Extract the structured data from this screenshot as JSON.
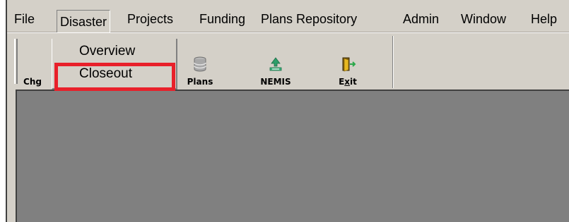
{
  "menubar": {
    "items": [
      "File",
      "Disaster",
      "Projects",
      "Funding",
      "Plans Repository",
      "Admin",
      "Window",
      "Help"
    ]
  },
  "dropdown": {
    "items": [
      "Overview",
      "Closeout"
    ],
    "highlighted": "Closeout",
    "highlight_color": "#e8202a"
  },
  "toolbar": {
    "buttons": [
      {
        "label": "Chg",
        "icon": "change-icon"
      },
      {
        "label": "Plans",
        "icon": "database-icon"
      },
      {
        "label": "NEMIS",
        "icon": "recycle-icon"
      },
      {
        "label": "Exit",
        "icon": "exit-door-icon"
      }
    ]
  },
  "colors": {
    "window_background": "#d4d0c8",
    "workspace_background": "#808080",
    "highlight_border": "#e8202a"
  }
}
